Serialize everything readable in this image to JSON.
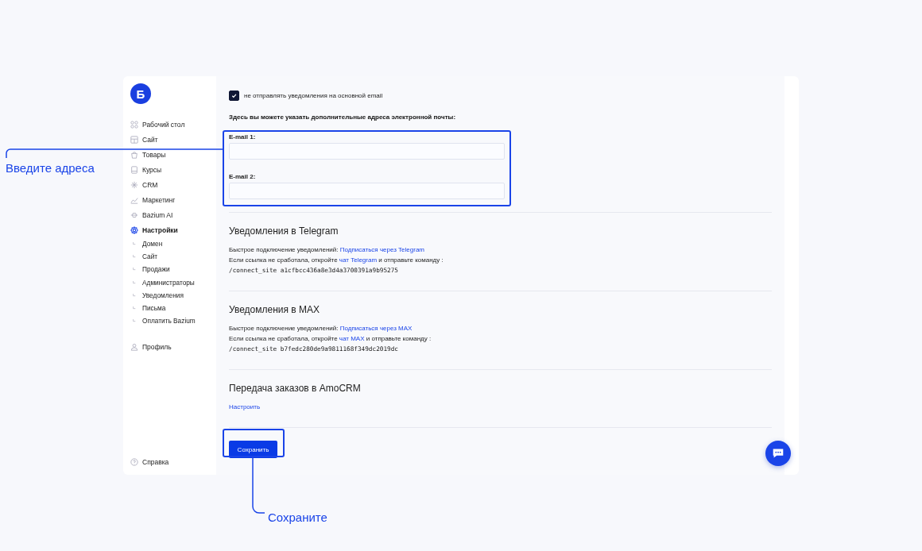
{
  "sidebar": {
    "logo": "Б",
    "items": [
      {
        "label": "Рабочий стол",
        "selected": false
      },
      {
        "label": "Сайт",
        "selected": false
      },
      {
        "label": "Товары",
        "selected": false
      },
      {
        "label": "Курсы",
        "selected": false
      },
      {
        "label": "CRM",
        "selected": false
      },
      {
        "label": "Маркетинг",
        "selected": false
      },
      {
        "label": "Bazium AI",
        "selected": false
      },
      {
        "label": "Настройки",
        "selected": true,
        "children": [
          {
            "label": "Домен",
            "selected": false
          },
          {
            "label": "Сайт",
            "selected": false
          },
          {
            "label": "Продажи",
            "selected": false
          },
          {
            "label": "Администраторы",
            "selected": false
          },
          {
            "label": "Уведомления",
            "selected": false
          },
          {
            "label": "Письма",
            "selected": false
          },
          {
            "label": "Оплатить Bazium",
            "selected": false
          }
        ]
      }
    ],
    "profile": "Профиль",
    "help": "Справка"
  },
  "email": {
    "checkbox": {
      "label": "не отправлять уведомления на основной email",
      "checked": true
    },
    "hint": "Здесь вы можете указать дополнительные адреса электронной почты:",
    "fields": [
      {
        "label": "E-mail 1:"
      },
      {
        "label": "E-mail 2:"
      }
    ]
  },
  "sections": [
    {
      "title": "Уведомления в Telegram",
      "line1": "Быстрое подключение уведомлений: ",
      "link1": "Подписаться через Telegram",
      "line2a": "Если ссылка не сработала, откройте ",
      "link2": "чат Telegram",
      "line2b": " и отправьте команду :",
      "command": "/connect_site a1cfbcc436a8e3d4a3700391a9b95275"
    },
    {
      "title": "Уведомления в MAX",
      "line1": "Быстрое подключение уведомлений: ",
      "link1": "Подписаться через MAX",
      "line2a": "Если ссылка не сработала, откройте ",
      "link2": "чат MAX",
      "line2b": " и отправьте команду :",
      "command": "/connect_site b7fedc280de9a9811168f349dc2019dc"
    },
    {
      "title": "Передача заказов в AmoCRM",
      "link1": "Настроить"
    }
  ],
  "save_button": "Сохранить",
  "annotations": [
    {
      "label": "Введите адреса"
    },
    {
      "label": "Сохраните"
    }
  ]
}
